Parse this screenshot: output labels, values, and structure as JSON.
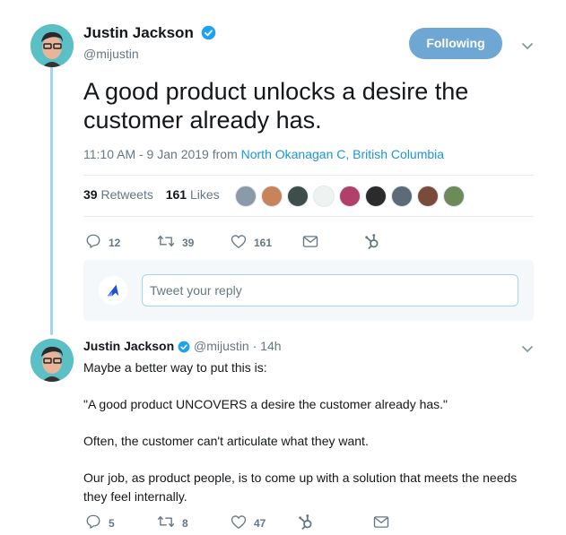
{
  "main_tweet": {
    "author_name": "Justin Jackson",
    "author_handle": "@mijustin",
    "follow_button": "Following",
    "text": "A good product unlocks a desire the customer already has.",
    "timestamp": "11:10 AM - 9 Jan 2019 from ",
    "location": "North Okanagan C, British Columbia",
    "retweets_count": "39",
    "retweets_label": "Retweets",
    "likes_count": "161",
    "likes_label": "Likes",
    "actions": {
      "replies": "12",
      "retweets": "39",
      "likes": "161"
    }
  },
  "reply_box": {
    "placeholder": "Tweet your reply"
  },
  "reply_tweet": {
    "author_name": "Justin Jackson",
    "author_handle": "@mijustin",
    "time": "· 14h",
    "paragraphs": [
      "Maybe a better way to put this is:",
      "\"A good product UNCOVERS a desire the customer already has.\"",
      "Often, the customer can't articulate what they want.",
      "Our job, as product people, is to come up with a solution that meets the needs they feel internally."
    ],
    "actions": {
      "replies": "5",
      "retweets": "8",
      "likes": "47"
    }
  },
  "colors": {
    "accent": "#1b95e0",
    "follow_bg": "#6fa7d4",
    "thread_line": "#a3d3f5",
    "muted": "#657786"
  }
}
